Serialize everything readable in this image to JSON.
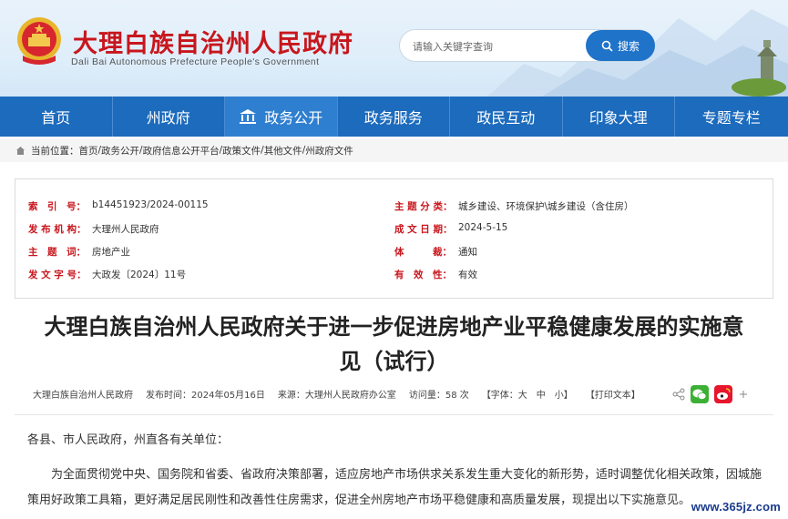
{
  "header": {
    "site_title": "大理白族自治州人民政府",
    "site_subtitle": "Dali Bai Autonomous Prefecture People's Government",
    "search_placeholder": "请输入关键字查询",
    "search_button": "搜索",
    "emblem_icon": "national-emblem-icon"
  },
  "nav": {
    "items": [
      {
        "label": "首页"
      },
      {
        "label": "州政府"
      },
      {
        "label": "政务公开"
      },
      {
        "label": "政务服务"
      },
      {
        "label": "政民互动"
      },
      {
        "label": "印象大理"
      },
      {
        "label": "专题专栏"
      }
    ],
    "active_index": 2
  },
  "breadcrumb": {
    "prefix": "当前位置：",
    "items": [
      "首页",
      "政务公开",
      "政府信息公开平台",
      "政策文件",
      "其他文件",
      "州政府文件"
    ],
    "separator": " / "
  },
  "meta": {
    "index_label": "索　引　号：",
    "index_value": "b14451923/2024-00115",
    "category_label": "主 题 分 类：",
    "category_value": "城乡建设、环境保护\\城乡建设（含住房）",
    "publisher_label": "发 布 机 构：",
    "publisher_value": "大理州人民政府",
    "date_label": "成 文 日 期：",
    "date_value": "2024-5-15",
    "keyword_label": "主　题　词：",
    "keyword_value": "房地产业",
    "genre_label": "体　　　裁：",
    "genre_value": "通知",
    "docno_label": "发 文 字 号：",
    "docno_value": "大政发〔2024〕11号",
    "validity_label": "有　效　性：",
    "validity_value": "有效"
  },
  "article": {
    "title_line1": "大理白族自治州人民政府关于进一步促进房地产业平稳健康发展的实施意",
    "title_line2": "见（试行）",
    "author": "大理白族自治州人民政府",
    "publish_time": "发布时间：2024年05月16日",
    "source": "来源：大理州人民政府办公室",
    "visits": "访问量：58 次",
    "font_size": "【字体：大　中　小】",
    "print": "【打印文本】",
    "salutation": "各县、市人民政府，州直各有关单位：",
    "paragraph1": "为全面贯彻党中央、国务院和省委、省政府决策部署，适应房地产市场供求关系发生重大变化的新形势，适时调整优化相关政策，因城施策用好政策工具箱，更好满足居民刚性和改善性住房需求，促进全州房地产市场平稳健康和高质量发展，现提出以下实施意见。"
  },
  "watermark": "www.365jz.com",
  "colors": {
    "brand_red": "#c8161d",
    "nav_blue": "#1c6bbd",
    "wechat_green": "#3cb034",
    "weibo_red": "#e6162d"
  }
}
